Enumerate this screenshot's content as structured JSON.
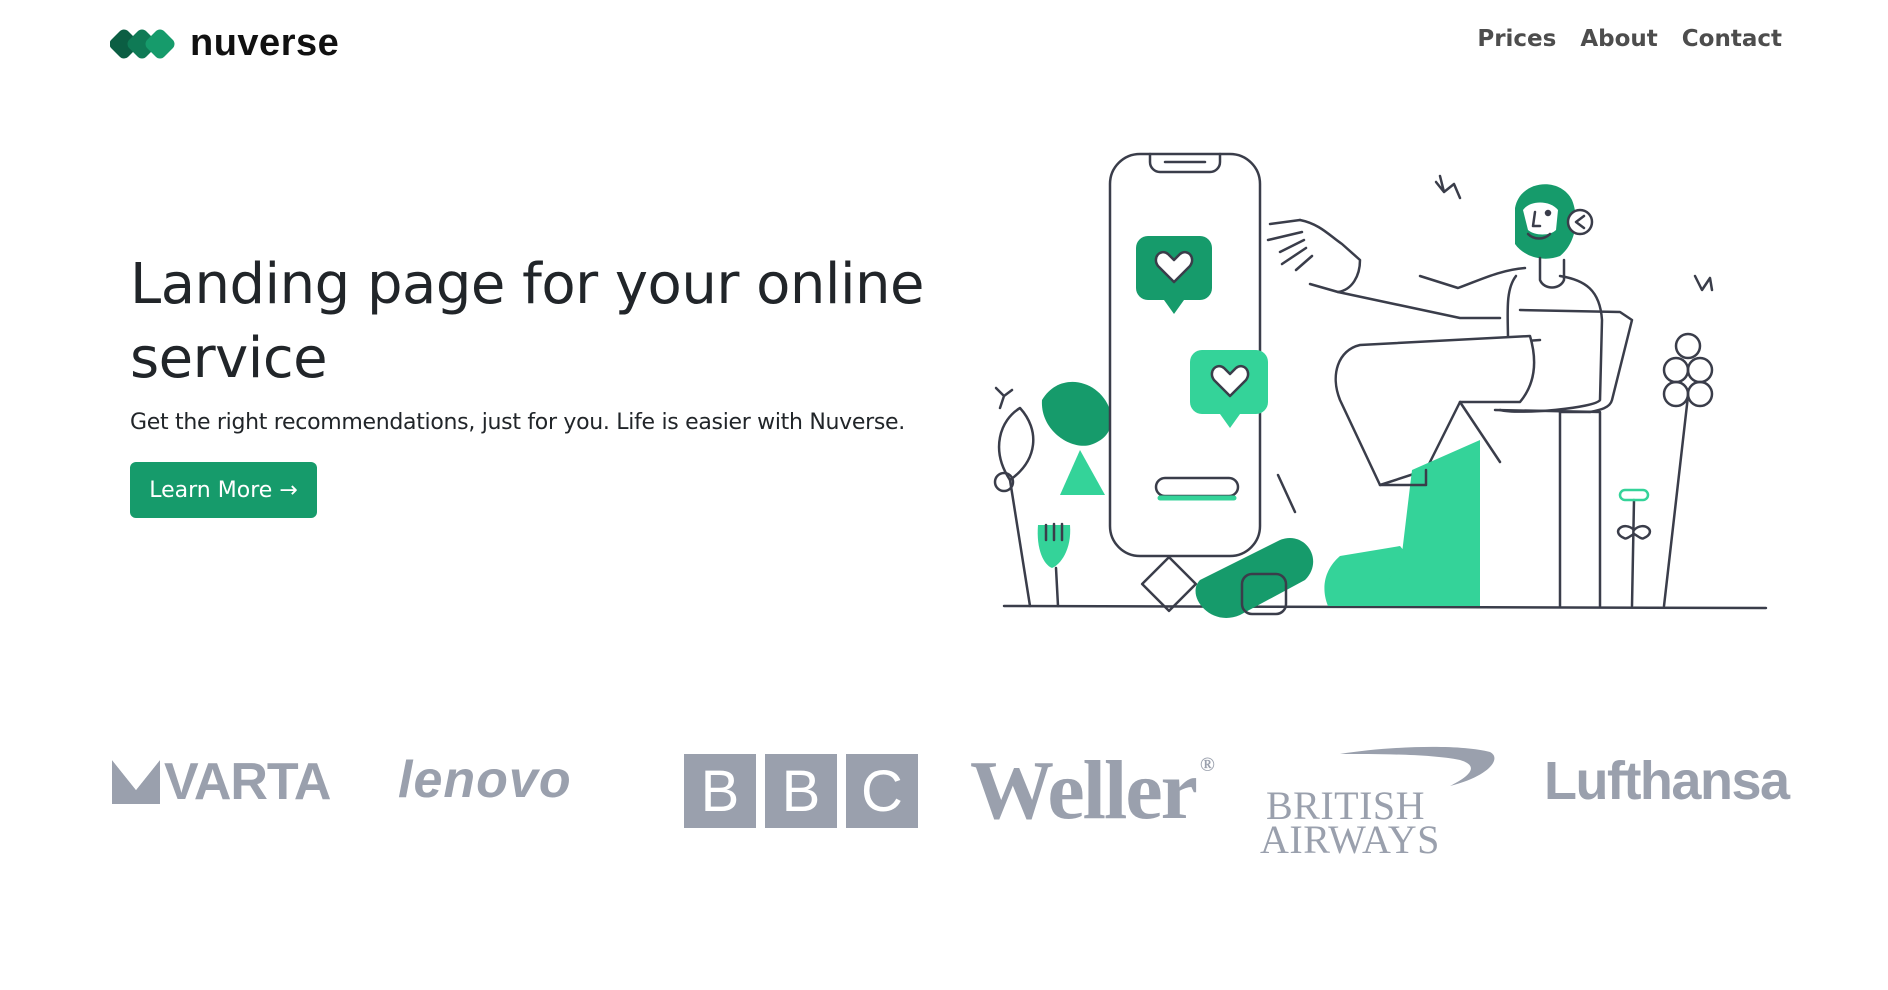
{
  "header": {
    "logo_text": "nuverse",
    "nav": [
      {
        "label": "Prices"
      },
      {
        "label": "About"
      },
      {
        "label": "Contact"
      }
    ]
  },
  "hero": {
    "title": "Landing page for your online service",
    "subtitle": "Get the right recommendations, just for you. Life is easier with Nuverse.",
    "cta_label": "Learn More →"
  },
  "brands": {
    "varta": "VARTA",
    "lenovo": "lenovo",
    "bbc": [
      "B",
      "B",
      "C"
    ],
    "weller": "Weller",
    "weller_reg": "®",
    "british_airways_1": "BRITISH",
    "british_airways_2": "AIRWAYS",
    "lufthansa": "Lufthansa"
  },
  "colors": {
    "primary": "#169b6b",
    "accent": "#34d399",
    "logo_gray": "#9aa0ad",
    "text": "#212529",
    "nav_text": "#4d4d4d",
    "line": "#3a3d4a"
  },
  "illustration": {
    "subject": "person-pointing-at-phone-with-heart-notifications",
    "icons": [
      "heart-icon",
      "heart-icon"
    ]
  }
}
